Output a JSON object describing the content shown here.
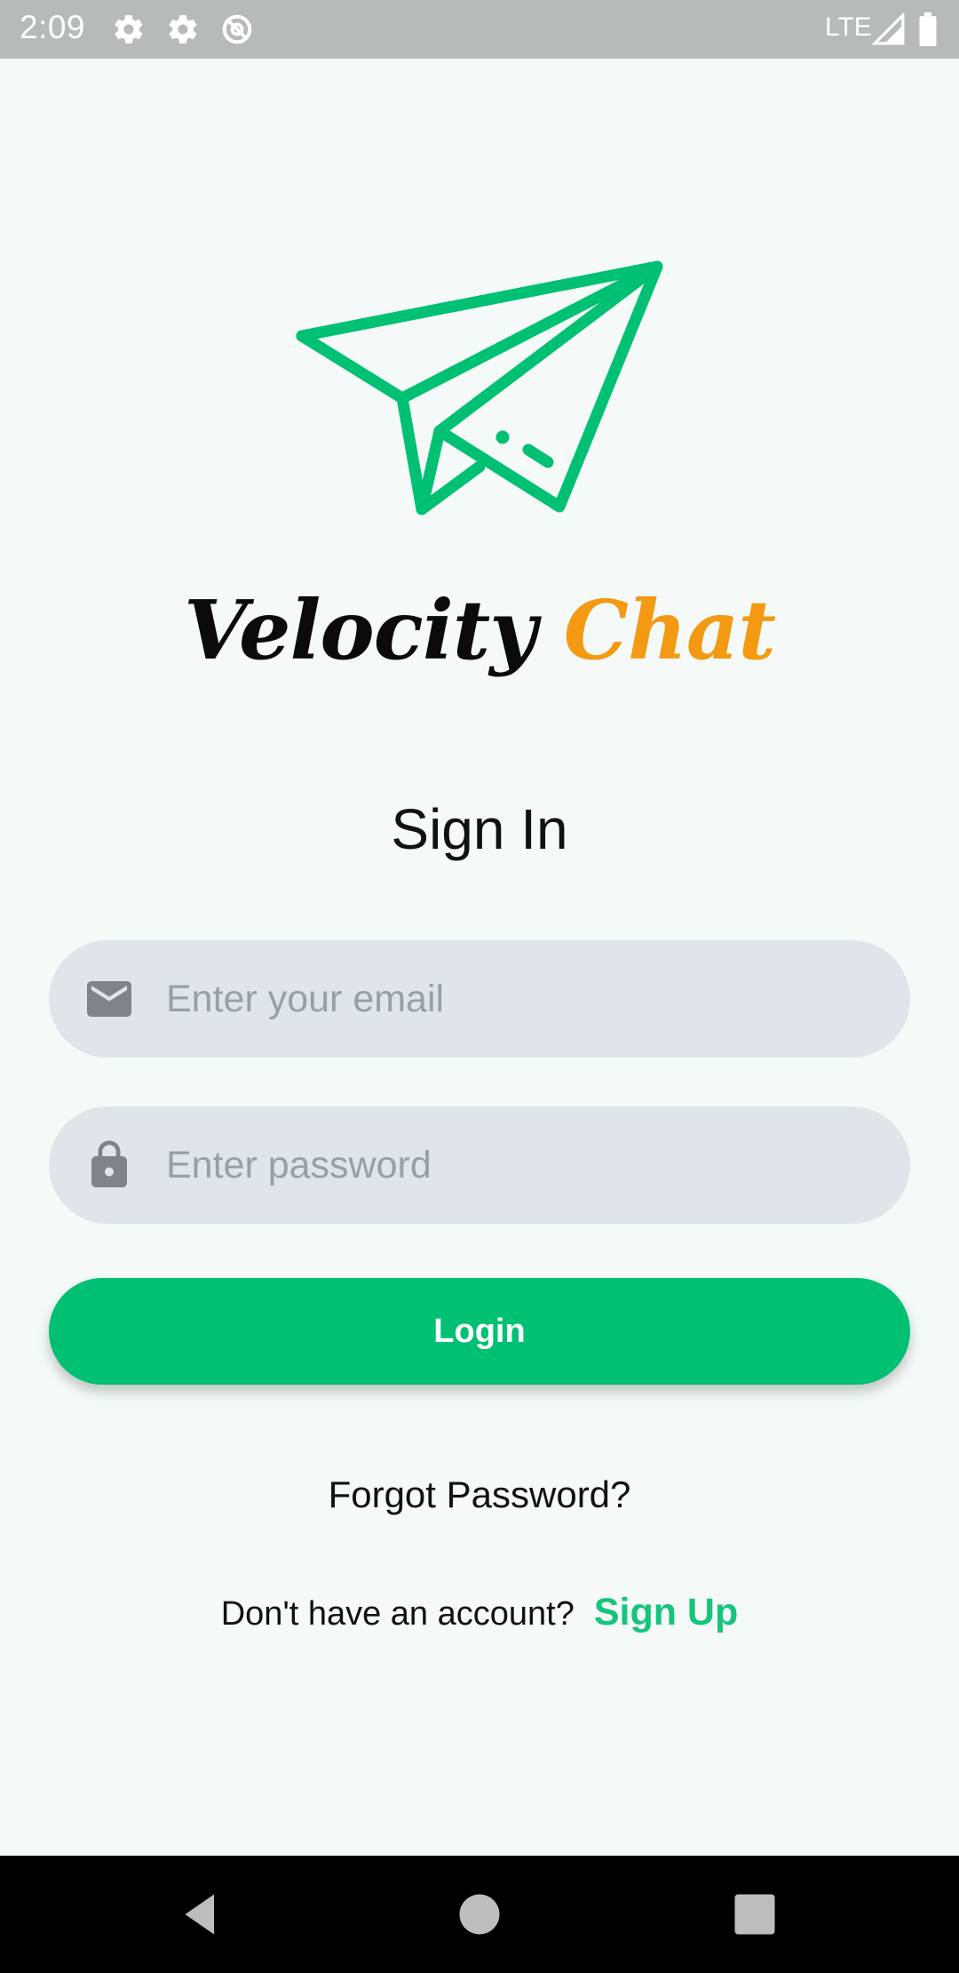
{
  "status_bar": {
    "time": "2:09",
    "network": "LTE",
    "icons": [
      "settings-icon",
      "settings-icon",
      "sync-icon",
      "signal-icon",
      "battery-icon"
    ]
  },
  "brand": {
    "name_part_1": "Velocity",
    "name_part_2": "Chat",
    "logo_icon": "paper-plane-icon",
    "colors": {
      "primary": "#00c073",
      "accent": "#f39a12"
    }
  },
  "signin": {
    "title": "Sign In",
    "email_placeholder": "Enter your email",
    "email_value": "",
    "email_icon": "mail-icon",
    "password_placeholder": "Enter password",
    "password_value": "",
    "password_icon": "lock-icon",
    "login_label": "Login",
    "forgot_label": "Forgot Password?",
    "signup_prompt": "Don't have an account?",
    "signup_label": "Sign Up"
  },
  "nav_bar": {
    "icons": [
      "back-icon",
      "home-icon",
      "recents-icon"
    ]
  }
}
